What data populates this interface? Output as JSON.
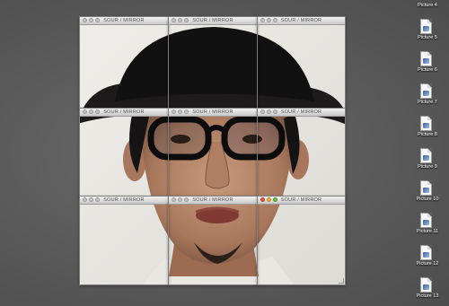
{
  "window_title": "SOUR / MIRROR",
  "files": [
    {
      "label": "Picture 4"
    },
    {
      "label": "Picture 5"
    },
    {
      "label": "Picture 6"
    },
    {
      "label": "Picture 7"
    },
    {
      "label": "Picture 8"
    },
    {
      "label": "Picture 9"
    },
    {
      "label": "Picture 10"
    },
    {
      "label": "Picture 11"
    },
    {
      "label": "Picture 12"
    },
    {
      "label": "Picture 13"
    }
  ],
  "colors": {
    "desktop": "#5c5c5c",
    "close": "#e8564d",
    "minimize": "#e4b33a",
    "zoom": "#6fbf45"
  },
  "icons": [
    "document-image-icon",
    "close-light-icon",
    "minimize-light-icon",
    "zoom-light-icon"
  ]
}
